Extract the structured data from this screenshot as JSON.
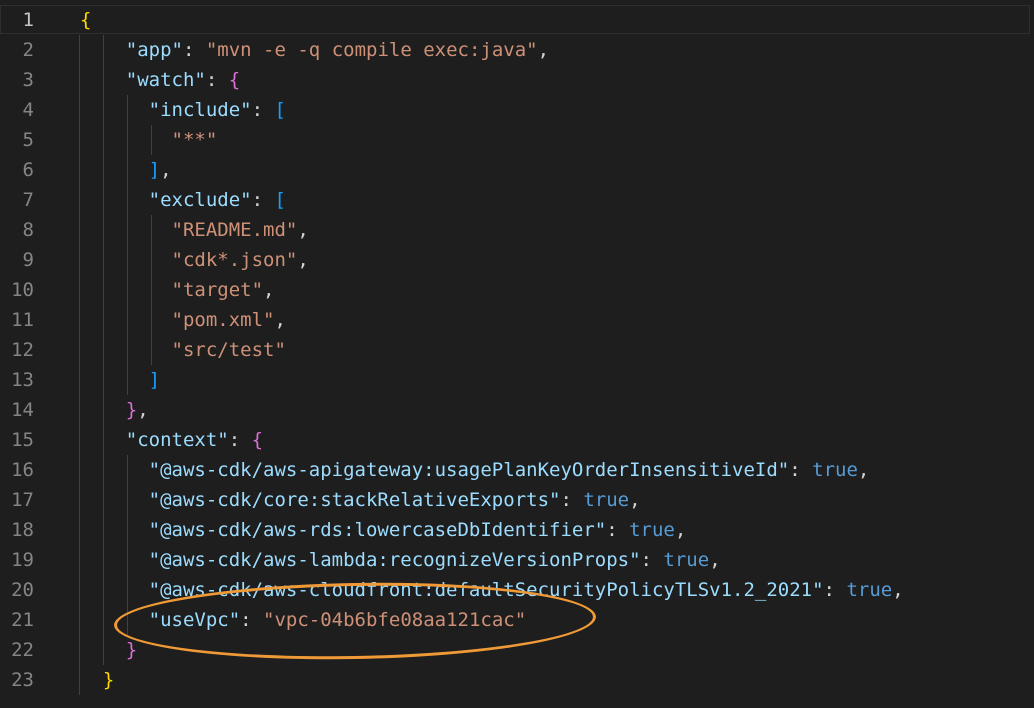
{
  "editor": {
    "active_line": 1,
    "line_numbers": [
      "1",
      "2",
      "3",
      "4",
      "5",
      "6",
      "7",
      "8",
      "9",
      "10",
      "11",
      "12",
      "13",
      "14",
      "15",
      "16",
      "17",
      "18",
      "19",
      "20",
      "21",
      "22",
      "23"
    ]
  },
  "code": {
    "l1_open": "{",
    "app_key": "\"app\"",
    "app_value": "\"mvn -e -q compile exec:java\"",
    "watch_key": "\"watch\"",
    "include_key": "\"include\"",
    "include_items": [
      "\"**\""
    ],
    "exclude_key": "\"exclude\"",
    "exclude_items": [
      "\"README.md\"",
      "\"cdk*.json\"",
      "\"target\"",
      "\"pom.xml\"",
      "\"src/test\""
    ],
    "context_key": "\"context\"",
    "context_entries": [
      {
        "key": "\"@aws-cdk/aws-apigateway:usagePlanKeyOrderInsensitiveId\"",
        "value": "true"
      },
      {
        "key": "\"@aws-cdk/core:stackRelativeExports\"",
        "value": "true"
      },
      {
        "key": "\"@aws-cdk/aws-rds:lowercaseDbIdentifier\"",
        "value": "true"
      },
      {
        "key": "\"@aws-cdk/aws-lambda:recognizeVersionProps\"",
        "value": "true"
      },
      {
        "key": "\"@aws-cdk/aws-cloudfront:defaultSecurityPolicyTLSv1.2_2021\"",
        "value": "true"
      }
    ],
    "usevpc_key": "\"useVpc\"",
    "usevpc_value": "\"vpc-04b6bfe08aa121cac\""
  },
  "colors": {
    "background": "#1e1e1e",
    "key": "#9cdcfe",
    "string": "#ce9178",
    "boolean": "#569cd6",
    "bracket_level1": "#ffd700",
    "bracket_level2": "#da70d6",
    "bracket_level3": "#179fff",
    "annotation": "#f09a37"
  }
}
